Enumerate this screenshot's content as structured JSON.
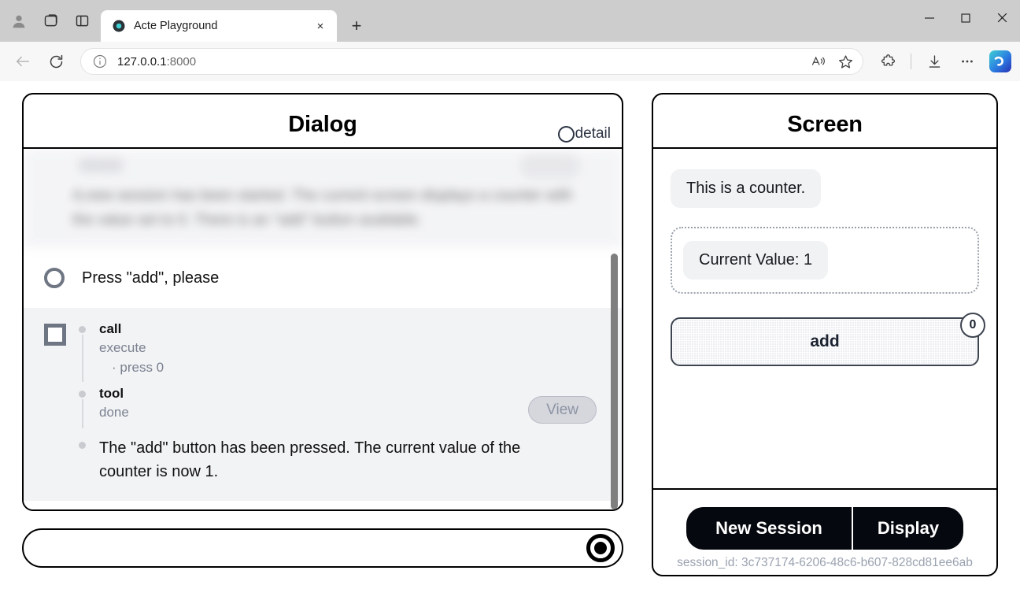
{
  "browser": {
    "tab": {
      "title": "Acte Playground",
      "favicon": "acte-logo-icon",
      "close_label": "×"
    },
    "new_tab_label": "+",
    "window_controls": {
      "minimize": "—",
      "maximize": "□",
      "close": "✕"
    },
    "address": {
      "host": "127.0.0.1",
      "port": ":8000",
      "full": "127.0.0.1:8000"
    },
    "toolbar_icons": [
      "back-icon",
      "reload-icon",
      "info-icon",
      "read-aloud-icon",
      "favorite-icon",
      "extensions-icon",
      "downloads-icon",
      "settings-more-icon",
      "copilot-icon"
    ],
    "profile_icons": [
      "profile-icon",
      "workspaces-icon",
      "split-screen-icon"
    ]
  },
  "dialog": {
    "title": "Dialog",
    "detail_toggle_label": "detail",
    "messages": {
      "blurred_preview": "A new session has been started. The current screen displays a counter with the value set to 0. There is an \"add\" button available.",
      "user_prompt": "Press \"add\", please",
      "trace": [
        {
          "label": "call",
          "lines": [
            "execute",
            "· press 0"
          ]
        },
        {
          "label": "tool",
          "lines": [
            "done"
          ],
          "action_label": "View"
        }
      ],
      "assistant_reply": "The \"add\" button has been pressed. The current value of the counter is now 1."
    },
    "composer": {
      "value": "",
      "placeholder": "",
      "record_button_label": "record-button"
    }
  },
  "screen": {
    "title": "Screen",
    "caption": "This is a counter.",
    "counter_label": "Current Value: 1",
    "add_button": {
      "label": "add",
      "badge": "0"
    },
    "footer": {
      "new_session_label": "New Session",
      "display_label": "Display",
      "session_id": "session_id: 3c737174-6206-48c6-b607-828cd81ee6ab"
    }
  },
  "colors": {
    "accent_teal": "#3fd0d4",
    "panel_border": "#000000",
    "muted_text": "#7b8190",
    "dark_button": "#06080f"
  }
}
